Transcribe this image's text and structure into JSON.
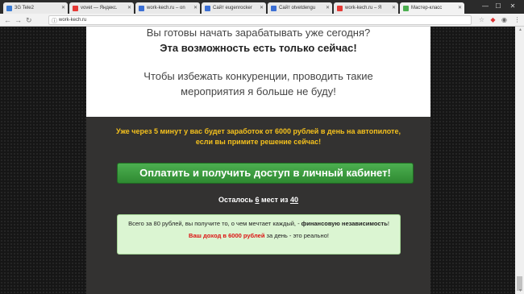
{
  "browser": {
    "tabs": [
      {
        "label": "3G Tele2",
        "favicon_color": "#3a7bd5"
      },
      {
        "label": "vovet — Яндекс.",
        "favicon_color": "#e53935"
      },
      {
        "label": "work-kech.ru – on",
        "favicon_color": "#3b6fd4"
      },
      {
        "label": "Сайт eugenrocker",
        "favicon_color": "#3b6fd4"
      },
      {
        "label": "Сайт otvetdengu",
        "favicon_color": "#3b6fd4"
      },
      {
        "label": "work-kech.ru – Я",
        "favicon_color": "#e53935"
      },
      {
        "label": "Мастер-класс",
        "favicon_color": "#4caf50"
      }
    ],
    "url": "work-kech.ru"
  },
  "page": {
    "intro_line1": "Вы готовы начать зарабатывать уже сегодня?",
    "intro_line2": "Эта возможность есть только сейчас!",
    "intro_line3": "Чтобы избежать конкуренции, проводить такие мероприятия я больше не буду!",
    "offer_text": "Уже через 5 минут у вас будет заработок от 6000 рублей в день на автопилоте, если вы примите решение сейчас!",
    "pay_button_label": "Оплатить и получить доступ в личный кабинет!",
    "remain_prefix": "Осталось",
    "remain_count": "6",
    "remain_middle": "мест из",
    "remain_total": "40",
    "box_text_1": "Всего за 80 рублей, вы получите то, о чем мечтает каждый, -",
    "box_text_bold": "финансовую независимость",
    "box_text_end": "!",
    "box_red": "Ваш доход в 6000 рублей",
    "box_text_tail": "за день - это реально!"
  },
  "colors": {
    "offer_yellow": "#f5c11d",
    "button_green": "#3c9d3f",
    "box_green": "#dbf5d2",
    "highlight_red": "#dd1111"
  }
}
